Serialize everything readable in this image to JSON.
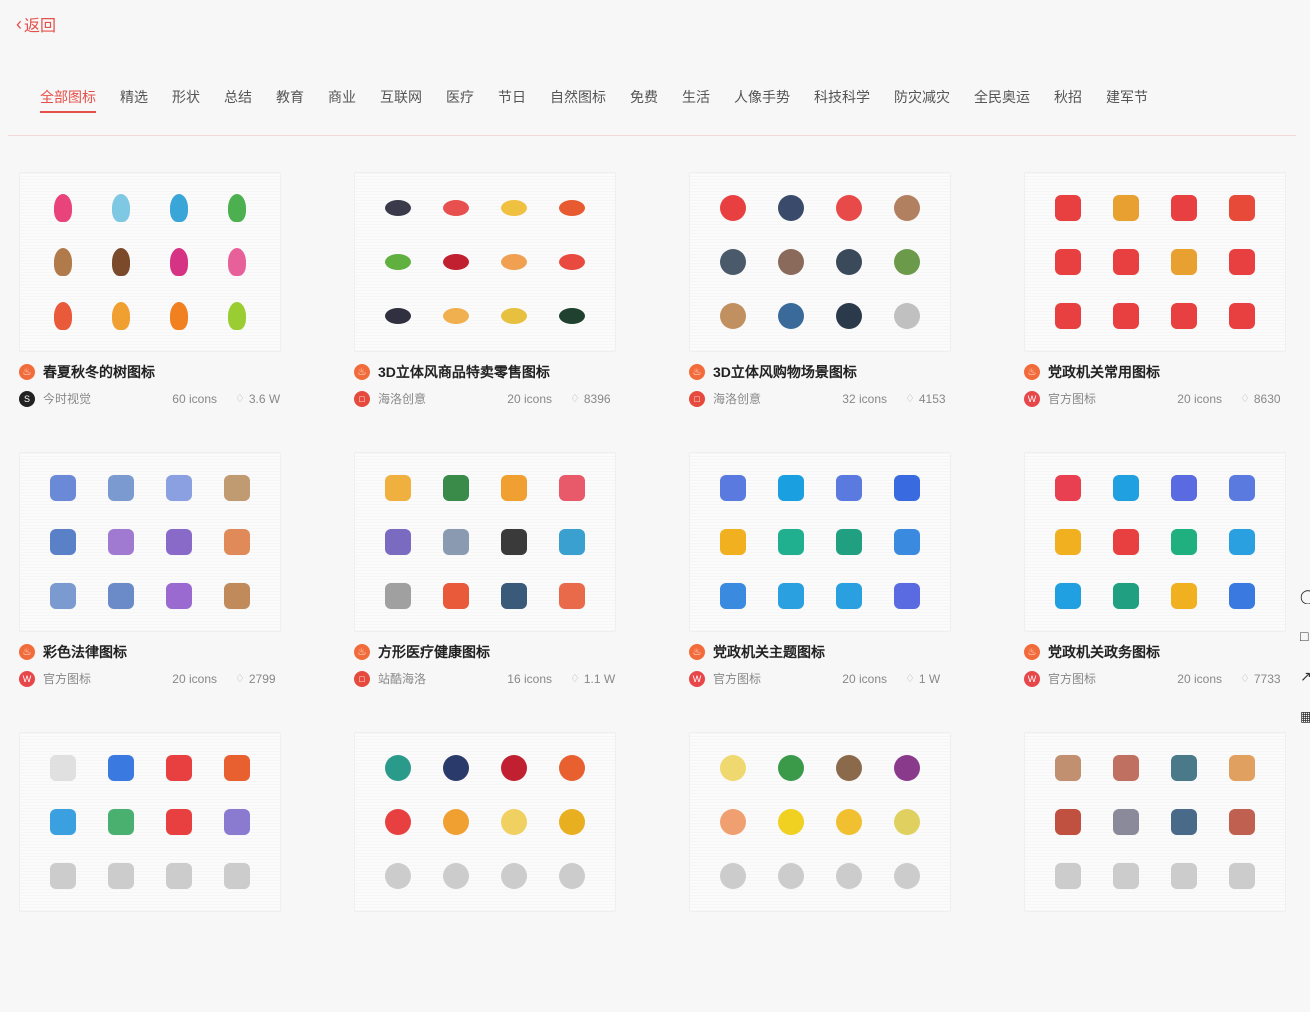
{
  "back_label": "返回",
  "tabs": [
    "全部图标",
    "精选",
    "形状",
    "总结",
    "教育",
    "商业",
    "互联网",
    "医疗",
    "节日",
    "自然图标",
    "免费",
    "生活",
    "人像手势",
    "科技科学",
    "防灾减灾",
    "全民奥运",
    "秋招",
    "建军节"
  ],
  "cards": [
    {
      "title": "春夏秋冬的树图标",
      "author": "今时视觉",
      "count": "60 icons",
      "views": "3.6 W",
      "avatar_color": "#222",
      "avatar_glyph": "S"
    },
    {
      "title": "3D立体风商品特卖零售图标",
      "author": "海洛创意",
      "count": "20 icons",
      "views": "8396",
      "avatar_color": "#e64a3c",
      "avatar_glyph": "□"
    },
    {
      "title": "3D立体风购物场景图标",
      "author": "海洛创意",
      "count": "32 icons",
      "views": "4153",
      "avatar_color": "#e64a3c",
      "avatar_glyph": "□"
    },
    {
      "title": "党政机关常用图标",
      "author": "官方图标",
      "count": "20 icons",
      "views": "8630",
      "avatar_color": "#e8474a",
      "avatar_glyph": "W"
    },
    {
      "title": "彩色法律图标",
      "author": "官方图标",
      "count": "20 icons",
      "views": "2799",
      "avatar_color": "#e8474a",
      "avatar_glyph": "W"
    },
    {
      "title": "方形医疗健康图标",
      "author": "站酷海洛",
      "count": "16 icons",
      "views": "1.1 W",
      "avatar_color": "#e64a3c",
      "avatar_glyph": "□"
    },
    {
      "title": "党政机关主题图标",
      "author": "官方图标",
      "count": "20 icons",
      "views": "1 W",
      "avatar_color": "#e8474a",
      "avatar_glyph": "W"
    },
    {
      "title": "党政机关政务图标",
      "author": "官方图标",
      "count": "20 icons",
      "views": "7733",
      "avatar_color": "#e8474a",
      "avatar_glyph": "W"
    },
    {
      "title": "",
      "author": "",
      "count": "",
      "views": "",
      "avatar_color": "",
      "avatar_glyph": ""
    },
    {
      "title": "",
      "author": "",
      "count": "",
      "views": "",
      "avatar_color": "",
      "avatar_glyph": ""
    },
    {
      "title": "",
      "author": "",
      "count": "",
      "views": "",
      "avatar_color": "",
      "avatar_glyph": ""
    },
    {
      "title": "",
      "author": "",
      "count": "",
      "views": "",
      "avatar_color": "",
      "avatar_glyph": ""
    }
  ],
  "thumb_icons": [
    {
      "style": "tree",
      "colors": [
        "#e8437a",
        "#7ec8e3",
        "#3aa6d8",
        "#4caf50",
        "#b07a4a",
        "#7a4a2a",
        "#d63384",
        "#e8609a",
        "#e85a3a",
        "#f0a030",
        "#f08020",
        "#9acd32"
      ]
    },
    {
      "style": "plate",
      "colors": [
        "#3a3a4a",
        "#e85050",
        "#f0c040",
        "#e85a30",
        "#60b040",
        "#c02030",
        "#f0a050",
        "#e84a40",
        "#303040",
        "#f0b050",
        "#e8c040",
        "#204030"
      ]
    },
    {
      "style": "round",
      "colors": [
        "#e84040",
        "#3a4a6a",
        "#e84a4a",
        "#b08060",
        "#4a5a6a",
        "#8a6a5a",
        "#3a4a5a",
        "#6a9a4a",
        "#c09060",
        "#3a6a9a",
        "#2a3a4a",
        "#c0c0c0"
      ]
    },
    {
      "style": "square",
      "colors": [
        "#e84040",
        "#e8a030",
        "#e84040",
        "#e84a3a",
        "#e84040",
        "#e84040",
        "#e8a030",
        "#e84040",
        "#e84040",
        "#e84040",
        "#e84040",
        "#e84040"
      ]
    },
    {
      "style": "square",
      "colors": [
        "#6a8ad8",
        "#7a9ad0",
        "#8aa0e0",
        "#c09a70",
        "#5a80c8",
        "#a07ad0",
        "#8a6ac8",
        "#e08a5a",
        "#7a9ad0",
        "#6a8ac8",
        "#9a6ad0",
        "#c08a5a"
      ]
    },
    {
      "style": "square",
      "colors": [
        "#f0b040",
        "#3a8a4a",
        "#f0a030",
        "#e85a6a",
        "#7a6ac0",
        "#8a9ab0",
        "#3a3a3a",
        "#3aa0d0",
        "#a0a0a0",
        "#e85a3a",
        "#3a5a7a",
        "#e86a4a"
      ]
    },
    {
      "style": "square",
      "colors": [
        "#5a7ae0",
        "#1aa0e0",
        "#5a7ae0",
        "#3a6ae0",
        "#f0b020",
        "#20b090",
        "#20a080",
        "#3a8ae0",
        "#3a8ae0",
        "#2aa0e0",
        "#2aa0e0",
        "#5a6ae0"
      ]
    },
    {
      "style": "square",
      "colors": [
        "#e84050",
        "#20a0e0",
        "#5a6ae0",
        "#5a7ae0",
        "#f0b020",
        "#e84040",
        "#20b080",
        "#2aa0e0",
        "#20a0e0",
        "#20a080",
        "#f0b020",
        "#3a7ae0"
      ]
    },
    {
      "style": "square",
      "colors": [
        "#e0e0e0",
        "#3a7ae0",
        "#e84040",
        "#e86030",
        "#3aa0e0",
        "#4ab070",
        "#e84040",
        "#8a7ad0",
        "#cccccc",
        "#cccccc",
        "#cccccc",
        "#cccccc"
      ]
    },
    {
      "style": "round",
      "colors": [
        "#2a9a8a",
        "#2a3a6a",
        "#c02030",
        "#e86030",
        "#e84040",
        "#f0a030",
        "#f0d060",
        "#e8b020",
        "#cccccc",
        "#cccccc",
        "#cccccc",
        "#cccccc"
      ]
    },
    {
      "style": "round",
      "colors": [
        "#f0d870",
        "#3a9a4a",
        "#8a6a4a",
        "#8a3a8a",
        "#f0a070",
        "#f0d020",
        "#f0c030",
        "#e0d060",
        "#cccccc",
        "#cccccc",
        "#cccccc",
        "#cccccc"
      ]
    },
    {
      "style": "square",
      "colors": [
        "#c09070",
        "#c07060",
        "#4a7a8a",
        "#e0a060",
        "#c05040",
        "#8a8a9a",
        "#4a6a8a",
        "#c06050",
        "#cccccc",
        "#cccccc",
        "#cccccc",
        "#cccccc"
      ]
    }
  ]
}
